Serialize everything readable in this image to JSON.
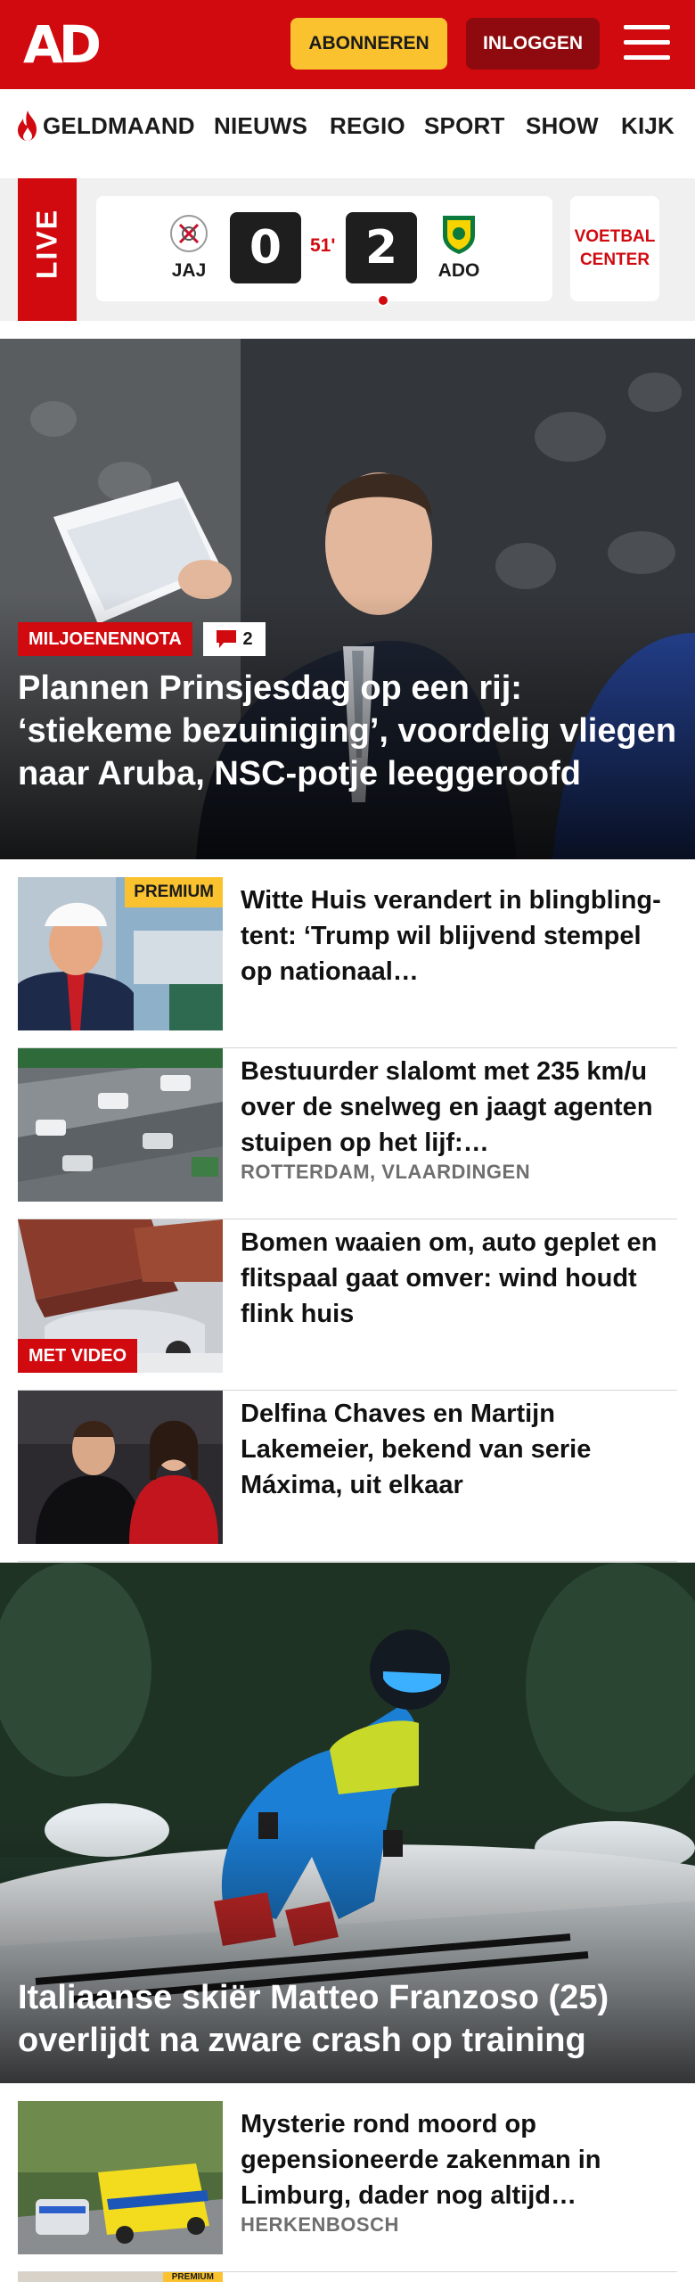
{
  "header": {
    "logo": "AD",
    "subscribe_label": "ABONNEREN",
    "login_label": "INLOGGEN",
    "menu_icon": "hamburger-icon"
  },
  "nav": {
    "items": [
      "GELDMAAND",
      "NIEUWS",
      "REGIO",
      "SPORT",
      "SHOW",
      "KIJK"
    ],
    "first_item_icon": "flame-icon"
  },
  "live": {
    "label": "LIVE",
    "home_team": "JAJ",
    "home_score": "0",
    "minute": "51'",
    "away_score": "2",
    "away_team": "ADO",
    "center_line1": "VOETBAL",
    "center_line2": "CENTER"
  },
  "hero": {
    "tag": "MILJOENENNOTA",
    "comment_count": "2",
    "title": "Plannen Prinsjesdag op een rij: ‘stiekeme bezuiniging’, voordelig vliegen naar Aruba, NSC-potje leegge­roofd"
  },
  "articles": [
    {
      "title": "Witte Huis verandert in blingbling-tent: ‘Trump wil blijvend stempel op nationaal…",
      "location": "",
      "badge": "PREMIUM",
      "video": ""
    },
    {
      "title": "Bestuurder slalomt met 235 km/u over de snelweg en jaagt agenten stuipen op het lijf:…",
      "location": "ROTTERDAM, VLAARDINGEN",
      "badge": "",
      "video": ""
    },
    {
      "title": "Bomen waaien om, auto geplet en flitspaal gaat omver: wind houdt flink huis",
      "location": "",
      "badge": "",
      "video": "MET VIDEO"
    },
    {
      "title": "Delfina Chaves en Martijn Lakemeier, bekend van serie Máxima, uit elkaar",
      "location": "",
      "badge": "",
      "video": ""
    }
  ],
  "hero2": {
    "title": "Italiaanse skiër Matteo Franzoso (25) overlijdt na zware crash op training"
  },
  "article_after": {
    "title": "Mysterie rond moord op gepensioneerde zakenman in Limburg, dader nog altijd…",
    "location": "HERKENBOSCH"
  },
  "article_partial": {
    "badge": "PREMIUM"
  },
  "colors": {
    "brand_red": "#d10a10",
    "accent_yellow": "#f9c22e",
    "login_dark_red": "#8f0a0e"
  }
}
